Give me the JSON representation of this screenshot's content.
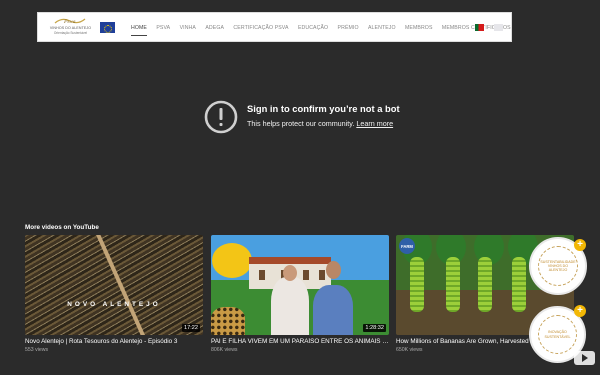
{
  "nav": {
    "logo_line1": "VINHOS DO ALENTEJO",
    "logo_line2": "Orientação Sustentável",
    "items": [
      {
        "label": "HOME",
        "active": true
      },
      {
        "label": "PSVA",
        "active": false
      },
      {
        "label": "VINHA",
        "active": false
      },
      {
        "label": "ADEGA",
        "active": false
      },
      {
        "label": "CERTIFICAÇÃO PSVA",
        "active": false
      },
      {
        "label": "EDUCAÇÃO",
        "active": false
      },
      {
        "label": "PRÉMIO",
        "active": false
      },
      {
        "label": "ALENTEJO",
        "active": false
      },
      {
        "label": "MEMBROS",
        "active": false
      },
      {
        "label": "MEMBROS CERTIFICADOS",
        "active": false
      }
    ]
  },
  "signin": {
    "title": "Sign in to confirm you’re not a bot",
    "subtitle": "This helps protect our community.",
    "link": "Learn more"
  },
  "more": {
    "heading": "More videos on YouTube",
    "videos": [
      {
        "title": "Novo Alentejo | Rota Tesouros do Alentejo - Episódio 3",
        "views": "553 views",
        "duration": "17:22",
        "thumb_text": "NOVO ALENTEJO"
      },
      {
        "title": "PAI E FILHA VIVEM EM UM PARAÍSO ENTRE OS ANIMAIS SELVAGENS",
        "views": "806K views",
        "duration": "1:28:32"
      },
      {
        "title": "How Millions of Bananas Are Grown, Harvested",
        "views": "650K views",
        "duration": "",
        "channel": "FARM"
      }
    ]
  },
  "badges": {
    "badge1_text": "SUSTENTABILIDADE VINHOS DO ALENTEJO",
    "badge2_text": "INOVAÇÃO SUSTENTÁVEL"
  },
  "colors": {
    "background": "#2b2b2b",
    "accent": "#f2b705"
  }
}
